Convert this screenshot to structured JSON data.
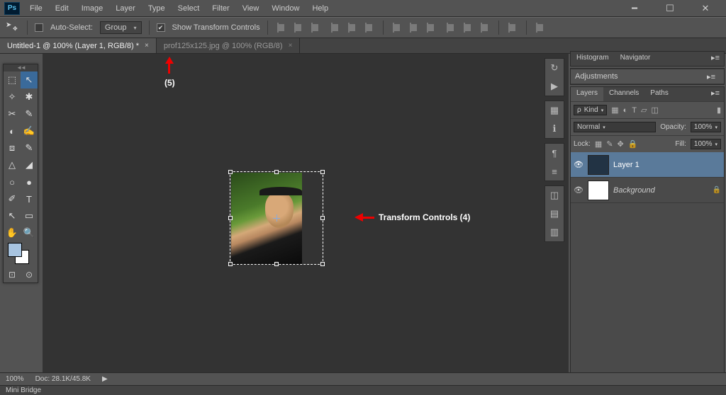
{
  "app": "Ps",
  "menu": [
    "File",
    "Edit",
    "Image",
    "Layer",
    "Type",
    "Select",
    "Filter",
    "View",
    "Window",
    "Help"
  ],
  "options": {
    "autoSelectLabel": "Auto-Select:",
    "autoSelectChecked": false,
    "groupDropdown": "Group",
    "showTransformLabel": "Show Transform Controls",
    "showTransformChecked": true
  },
  "tabs": [
    {
      "title": "Untitled-1 @ 100% (Layer 1, RGB/8) *",
      "active": true
    },
    {
      "title": "prof125x125.jpg @ 100% (RGB/8)",
      "active": false
    }
  ],
  "rightPanelTabs": {
    "top": [
      "Histogram",
      "Navigator"
    ],
    "adjustments": "Adjustments",
    "layers": [
      "Layers",
      "Channels",
      "Paths"
    ]
  },
  "layersPanel": {
    "kindLabel": "Kind",
    "blend": "Normal",
    "opacityLabel": "Opacity:",
    "opacityValue": "100%",
    "lockLabel": "Lock:",
    "fillLabel": "Fill:",
    "fillValue": "100%",
    "layers": [
      {
        "name": "Layer 1",
        "selected": true,
        "visible": true,
        "locked": false
      },
      {
        "name": "Background",
        "selected": false,
        "visible": true,
        "locked": true,
        "italic": true
      }
    ]
  },
  "status": {
    "zoom": "100%",
    "doc": "Doc: 28.1K/45.8K"
  },
  "miniBridge": "Mini Bridge",
  "annotations": {
    "a4": "Transform Controls  (4)",
    "a5": "(5)"
  },
  "tools": [
    "⬚",
    "↖",
    "✧",
    "✱",
    "⬳",
    "ℓ",
    "✂",
    "✎",
    "◐",
    "✍",
    "⧈",
    "✎",
    "△",
    "◢",
    "✐",
    "T",
    "↖",
    "▭",
    "✋",
    "🔍"
  ],
  "toolbot": [
    "⊡",
    "⊙"
  ]
}
